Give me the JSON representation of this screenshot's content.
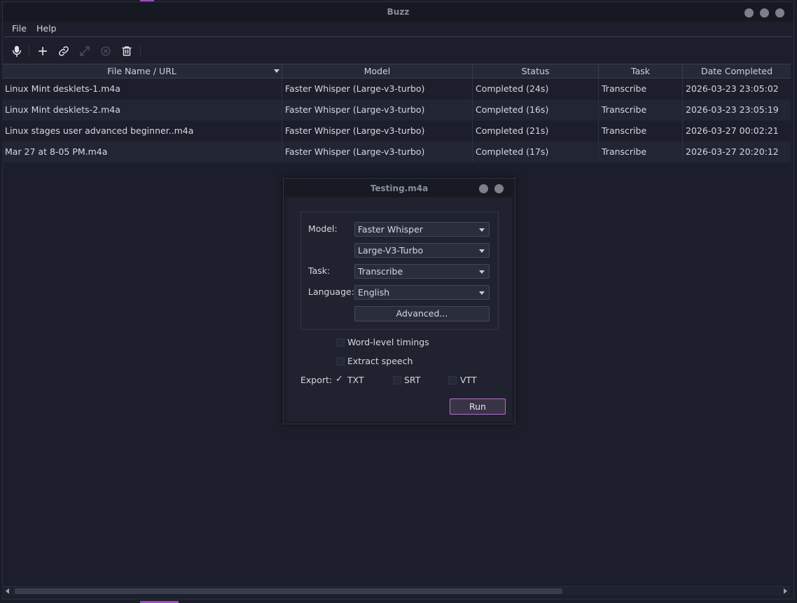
{
  "window": {
    "title": "Buzz"
  },
  "menu": {
    "items": [
      "File",
      "Help"
    ]
  },
  "toolbar": {
    "icons": [
      "microphone-icon",
      "plus-icon",
      "link-icon",
      "expand-icon",
      "cancel-icon",
      "trash-icon"
    ]
  },
  "table": {
    "columns": [
      "File Name / URL",
      "Model",
      "Status",
      "Task",
      "Date Completed"
    ],
    "rows": [
      [
        "Linux Mint desklets-1.m4a",
        "Faster Whisper (Large-v3-turbo)",
        "Completed (24s)",
        "Transcribe",
        "2026-03-23 23:05:02"
      ],
      [
        "Linux Mint desklets-2.m4a",
        "Faster Whisper (Large-v3-turbo)",
        "Completed (16s)",
        "Transcribe",
        "2026-03-23 23:05:19"
      ],
      [
        "Linux stages user advanced beginner..m4a",
        "Faster Whisper (Large-v3-turbo)",
        "Completed (21s)",
        "Transcribe",
        "2026-03-27 00:02:21"
      ],
      [
        "Mar 27 at 8-05 PM.m4a",
        "Faster Whisper (Large-v3-turbo)",
        "Completed (17s)",
        "Transcribe",
        "2026-03-27 20:20:12"
      ]
    ]
  },
  "dialog": {
    "title": "Testing.m4a",
    "model_label": "Model:",
    "model_value": "Faster Whisper",
    "model_size_value": "Large-V3-Turbo",
    "task_label": "Task:",
    "task_value": "Transcribe",
    "language_label": "Language:",
    "language_value": "English",
    "advanced_label": "Advanced...",
    "word_timings_label": "Word-level timings",
    "extract_speech_label": "Extract speech",
    "export_label": "Export:",
    "export_txt": "TXT",
    "export_srt": "SRT",
    "export_vtt": "VTT",
    "run_label": "Run"
  },
  "colors": {
    "background": "#1a1d28",
    "accent": "#b06fc7",
    "alt_row": "#222634"
  }
}
